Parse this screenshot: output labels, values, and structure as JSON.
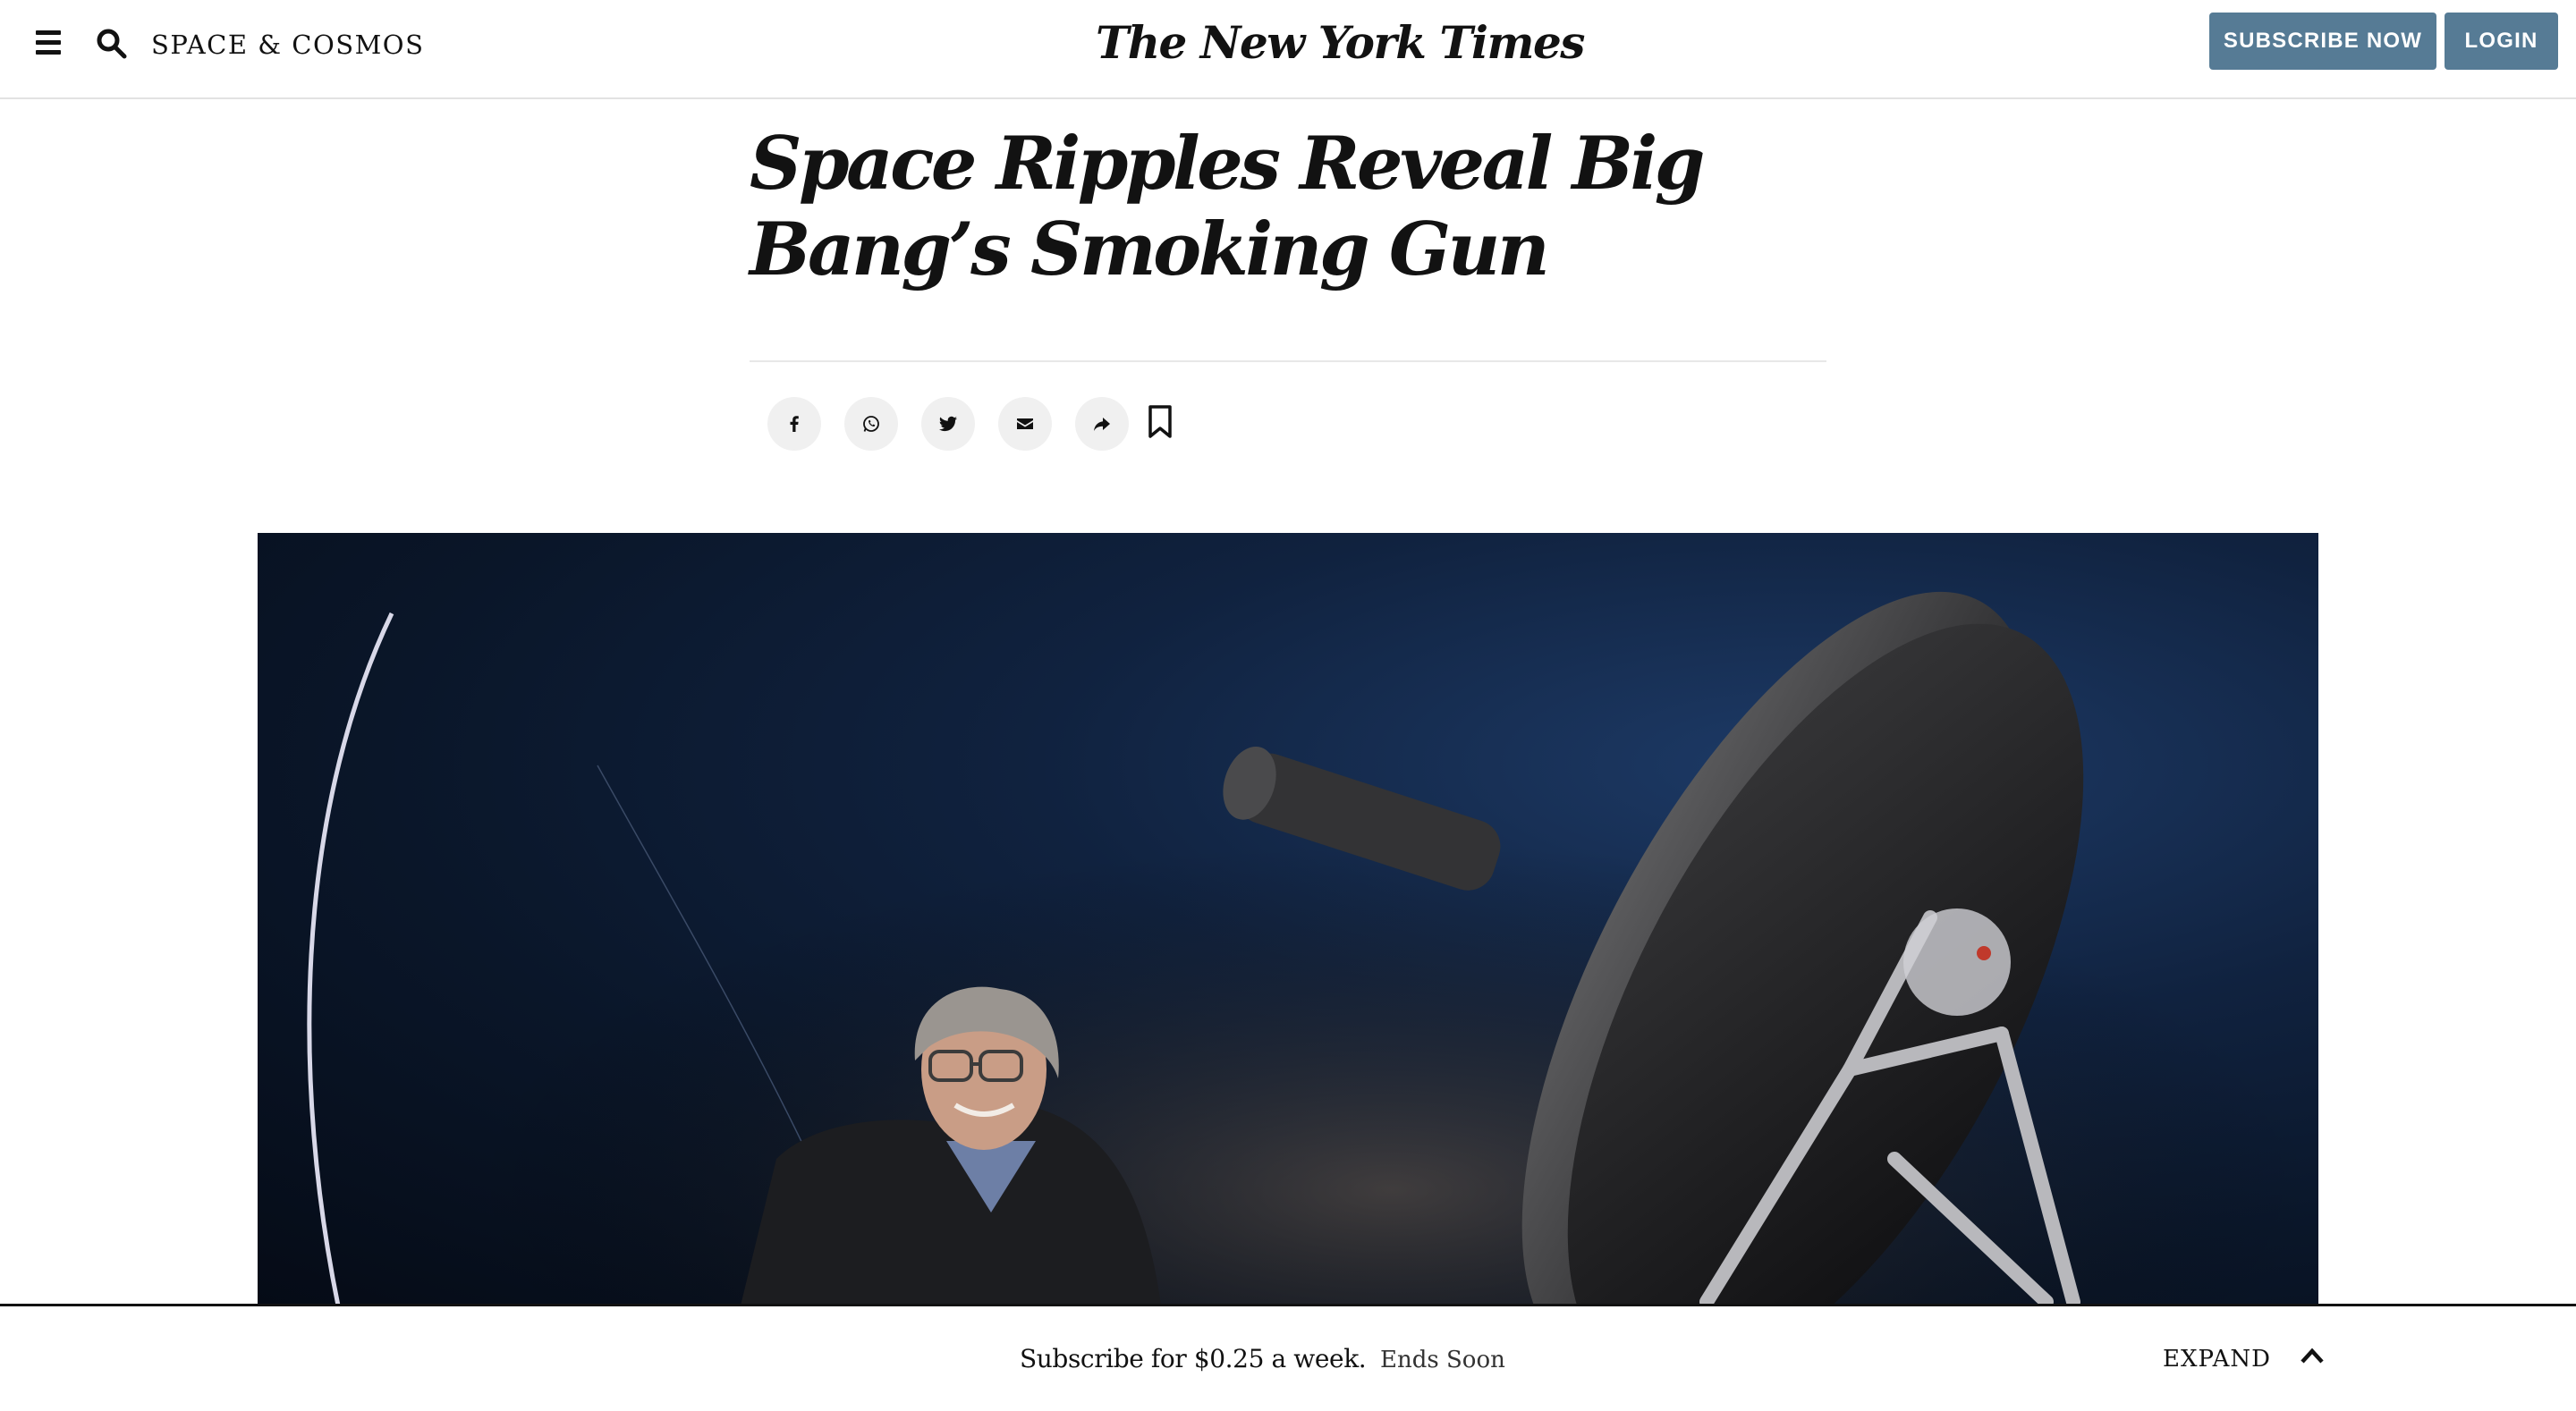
{
  "header": {
    "menu_icon": "hamburger-menu-icon",
    "search_icon": "search-icon",
    "section": "SPACE & COSMOS",
    "logo": "The New York Times",
    "subscribe_label": "SUBSCRIBE NOW",
    "login_label": "LOGIN"
  },
  "article": {
    "headline": "Space Ripples Reveal Big Bang’s Smoking Gun"
  },
  "share": {
    "buttons": [
      "facebook-icon",
      "whatsapp-icon",
      "twitter-icon",
      "email-icon",
      "share-icon",
      "bookmark-icon"
    ]
  },
  "subscribe_bar": {
    "offer": "Subscribe for $0.25 a week.",
    "ends": "Ends Soon",
    "expand_label": "EXPAND",
    "expand_icon": "chevron-up-icon"
  },
  "colors": {
    "button_blue": "#567b95",
    "text": "#121212",
    "share_circle": "#f0f0f0"
  }
}
